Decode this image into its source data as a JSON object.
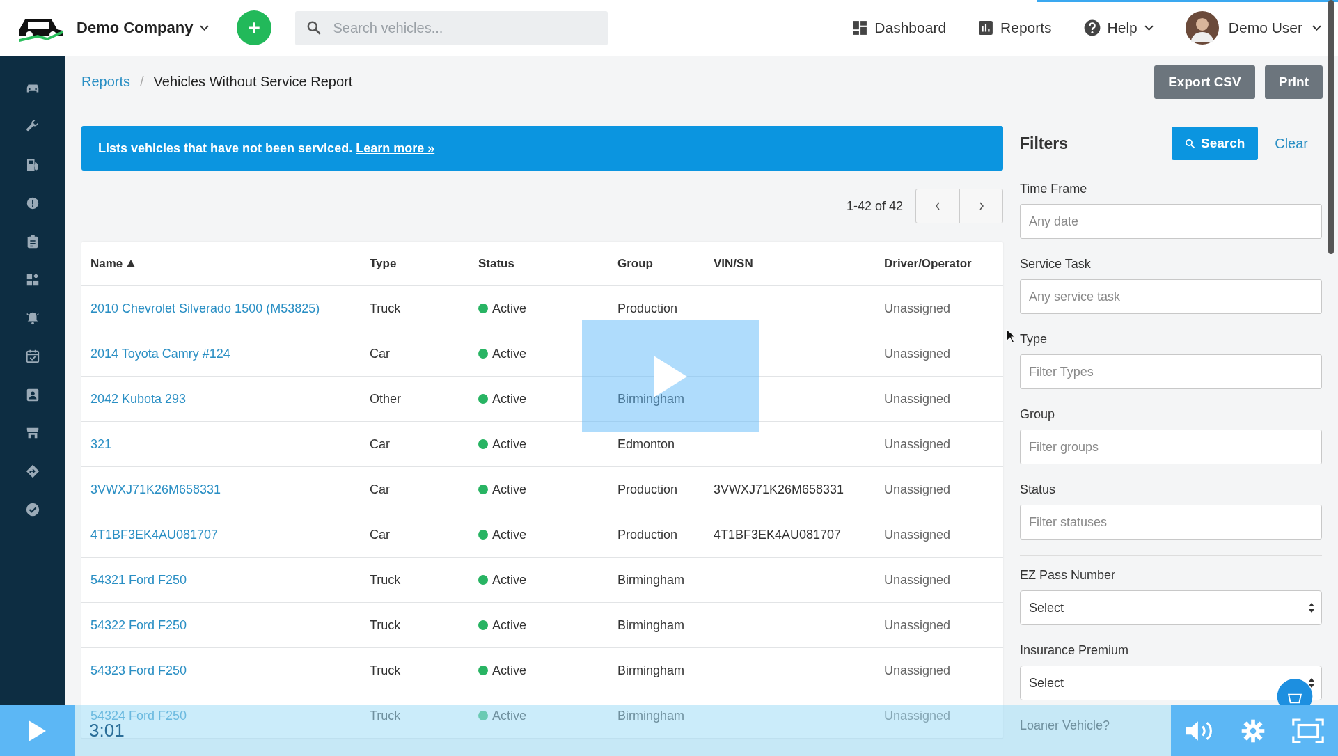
{
  "app": {
    "company": "Demo Company",
    "search": {
      "placeholder": "Search vehicles..."
    },
    "nav": [
      {
        "kind": "dashboard",
        "label": "Dashboard",
        "dropdown": false
      },
      {
        "kind": "reports",
        "label": "Reports",
        "dropdown": false
      },
      {
        "kind": "help",
        "label": "Help",
        "dropdown": true
      }
    ],
    "user": "Demo User",
    "breadcrumb": {
      "parent": "Reports",
      "separator": "/",
      "current": "Vehicles Without Service Report"
    },
    "actions": [
      "Export CSV",
      "Print"
    ],
    "banner": {
      "text": "Lists vehicles that have not been serviced.",
      "link": "Learn more »"
    },
    "pager": {
      "range": "1-42 of 42"
    },
    "table": {
      "columns": [
        {
          "label": "Name",
          "sorted": true
        },
        {
          "label": "Type"
        },
        {
          "label": "Status"
        },
        {
          "label": "Group"
        },
        {
          "label": "VIN/SN"
        },
        {
          "label": "Driver/Operator"
        }
      ],
      "rows": [
        {
          "name": "2010 Chevrolet Silverado 1500 (M53825)",
          "type": "Truck",
          "status": "Active",
          "group": "Production",
          "driver": "Unassigned"
        },
        {
          "name": "2014 Toyota Camry #124",
          "type": "Car",
          "status": "Active",
          "driver": "Unassigned"
        },
        {
          "name": "2042 Kubota 293",
          "type": "Other",
          "status": "Active",
          "group": "Birmingham",
          "driver": "Unassigned"
        },
        {
          "name": "321",
          "type": "Car",
          "status": "Active",
          "group": "Edmonton",
          "driver": "Unassigned"
        },
        {
          "name": "3VWXJ71K26M658331",
          "type": "Car",
          "status": "Active",
          "group": "Production",
          "vin": "3VWXJ71K26M658331",
          "driver": "Unassigned"
        },
        {
          "name": "4T1BF3EK4AU081707",
          "type": "Car",
          "status": "Active",
          "group": "Production",
          "vin": "4T1BF3EK4AU081707",
          "driver": "Unassigned"
        },
        {
          "name": "54321 Ford F250",
          "type": "Truck",
          "status": "Active",
          "group": "Birmingham",
          "driver": "Unassigned"
        },
        {
          "name": "54322 Ford F250",
          "type": "Truck",
          "status": "Active",
          "group": "Birmingham",
          "driver": "Unassigned"
        },
        {
          "name": "54323 Ford F250",
          "type": "Truck",
          "status": "Active",
          "group": "Birmingham",
          "driver": "Unassigned"
        },
        {
          "name": "54324 Ford F250",
          "type": "Truck",
          "status": "Active",
          "group": "Birmingham",
          "driver": "Unassigned"
        }
      ]
    },
    "filters": {
      "title": "Filters",
      "search_button": "Search",
      "clear": "Clear",
      "fields": [
        {
          "kind": "text",
          "label": "Time Frame",
          "placeholder": "Any date"
        },
        {
          "kind": "text",
          "label": "Service Task",
          "placeholder": "Any service task"
        },
        {
          "kind": "text",
          "label": "Type",
          "placeholder": "Filter Types"
        },
        {
          "kind": "text",
          "label": "Group",
          "placeholder": "Filter groups"
        },
        {
          "kind": "text",
          "label": "Status",
          "placeholder": "Filter statuses"
        },
        {
          "kind": "select",
          "label": "EZ Pass Number",
          "value": "Select",
          "divider_before": true
        },
        {
          "kind": "select",
          "label": "Insurance Premium",
          "value": "Select"
        },
        {
          "kind": "label",
          "label": "Loaner Vehicle?"
        }
      ]
    }
  },
  "video_player": {
    "time": "3:01"
  }
}
